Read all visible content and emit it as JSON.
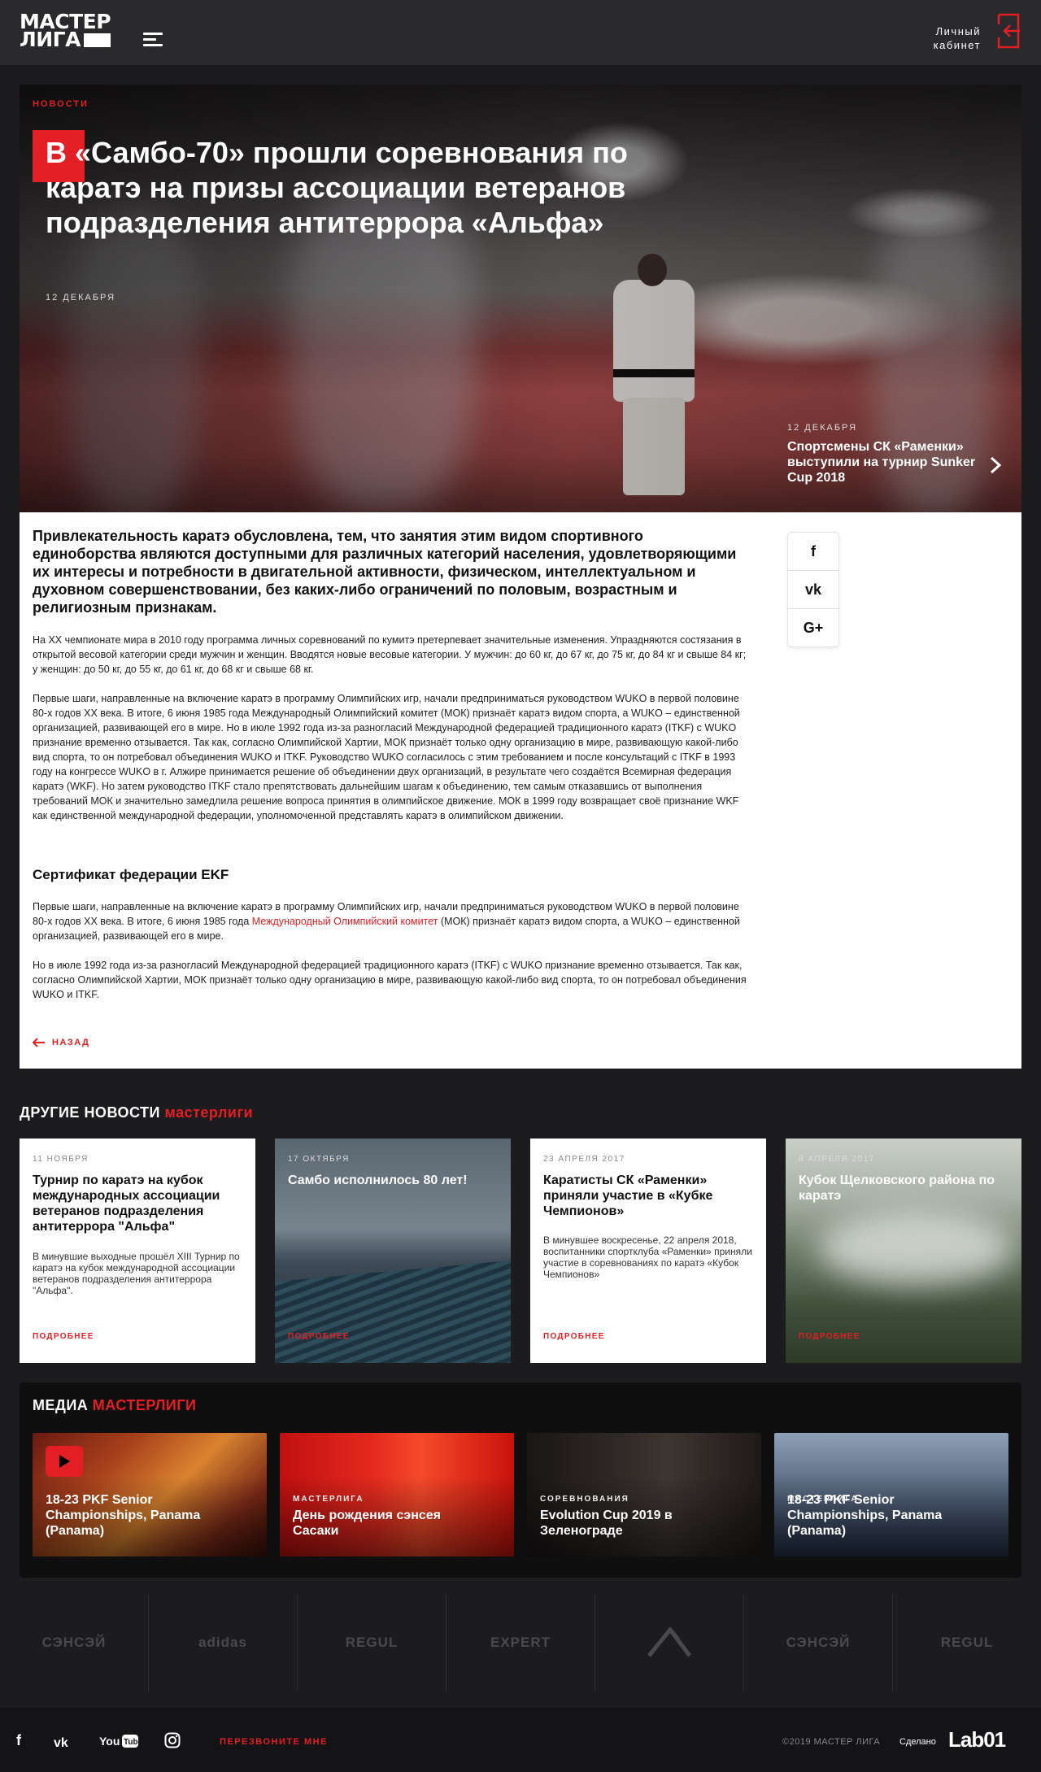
{
  "header": {
    "logo_line1": "МАСТЕР",
    "logo_line2": "ЛИГА",
    "cabinet_line1": "Личный",
    "cabinet_line2": "кабинет"
  },
  "hero": {
    "category": "НОВОСТИ",
    "title": "В «Самбо-70» прошли соревнования по каратэ на призы ассоциации ветеранов подразделения антитеррора «Альфа»",
    "date": "12 ДЕКАБРЯ",
    "next_date": "12 ДЕКАБРЯ",
    "next_title": "Спортсмены СК «Раменки» выступили на турнир Sunker Cup 2018"
  },
  "article": {
    "lead": "Привлекательность каратэ обусловлена, тем, что занятия этим видом спортивного единоборства являются доступными для различных категорий населения, удовлетворяющими их интересы и потребности в двигательной активности, физическом, интеллектуальном и духовном совершенствовании, без каких-либо ограничений по половым, возрастным и религиозным признакам.",
    "p1": "На XX чемпионате мира в 2010 году программа личных соревнований по кумитэ претерпевает значительные изменения. Упраздняются состязания в открытой весовой категории среди мужчин и женщин. Вводятся новые весовые категории. У мужчин: до 60 кг, до 67 кг, до 75 кг, до 84 кг и свыше 84 кг; у женщин: до 50 кг, до 55 кг, до 61 кг, до 68 кг и свыше 68 кг.",
    "p2": "Первые шаги, направленные на включение каратэ в программу Олимпийских игр, начали предприниматься руководством WUKO в первой половине 80-х годов XX века. В итоге, 6 июня 1985 года Международный Олимпийский комитет (МОК) признаёт каратэ видом спорта, а WUKO – единственной организацией, развивающей его в мире. Но в июле 1992 года из-за разногласий Международной федерацией традиционного каратэ (ITKF) с WUKO признание временно отзывается. Так как, согласно Олимпийской Хартии, МОК признаёт только одну организацию в мире, развивающую какой-либо вид спорта, то он потребовал объединения WUKO и ITKF. Руководство WUKO согласилось с этим требованием и после консультаций с ITKF в 1993 году на конгрессе WUKO в г. Алжире принимается решение об объединении двух организаций, в результате чего создаётся Всемирная федерация каратэ (WKF). Но затем руководство ITKF стало препятствовать дальнейшим шагам к объединению, тем самым отказавшись от выполнения требований МОК и значительно замедлила решение вопроса принятия в олимпийское движение. МОК в 1999 году возвращает своё признание WKF как единственной международной федерации, уполномоченной представлять каратэ в олимпийском движении.",
    "cert_title": "Сертификат федерации EKF",
    "p3_a": "Первые шаги, направленные на включение каратэ в программу Олимпийских игр, начали предприниматься руководством WUKO в первой половине 80-х годов XX века. В итоге, 6 июня 1985 года ",
    "p3_link": "Международный Олимпийский комитет",
    "p3_b": " (МОК) признаёт каратэ видом спорта, а WUKO – единственной организацией, развивающей его в мире.",
    "p4": "Но в июле 1992 года из-за разногласий Международной федерацией традиционного каратэ (ITKF) с WUKO признание временно отзывается. Так как, согласно Олимпийской Хартии, МОК признаёт только одну организацию в мире, развивающую какой-либо вид спорта, то он потребовал объединения WUKO и ITKF.",
    "back_label": "НАЗАД",
    "share": [
      "f",
      "vk",
      "G+"
    ]
  },
  "other_news": {
    "title_white": "ДРУГИЕ НОВОСТИ",
    "title_red": "мастерлиги",
    "cards": [
      {
        "date": "11 НОЯБРЯ",
        "title": "Турнир по каратэ на кубок международных ассоциации ветеранов подразделения антитеррора \"Альфа\"",
        "text": "В минувшие выходные прошёл XIII Турнир по каратэ на кубок международной ассоциации ветеранов подразделения антитеррора \"Альфа\".",
        "more": "ПОДРОБНЕЕ"
      },
      {
        "date": "17 ОКТЯБРЯ",
        "title": "Самбо исполнилось 80 лет!",
        "text": "",
        "more": "ПОДРОБНЕЕ"
      },
      {
        "date": "23 АПРЕЛЯ 2017",
        "title": "Каратисты СК «Раменки» приняли участие в «Кубке Чемпионов»",
        "text": "В минувшее воскресенье, 22 апреля 2018, воспитанники спортклуба «Раменки» приняли участие в соревнованиях по каратэ «Кубок Чемпионов»",
        "more": "ПОДРОБНЕЕ"
      },
      {
        "date": "8 АПРЕЛЯ 2017",
        "title": "Кубок Щелковского района по каратэ",
        "text": "",
        "more": "ПОДРОБНЕЕ"
      }
    ]
  },
  "media": {
    "title_white": "МЕДИА",
    "title_red": "МАСТЕРЛИГИ",
    "cards": [
      {
        "category": "",
        "title": "18-23 PKF Senior Championships, Panama (Panama)"
      },
      {
        "category": "МАСТЕРЛИГА",
        "title": "День рождения сэнсея Сасаки"
      },
      {
        "category": "СОРЕВНОВАНИЯ",
        "title": "Evolution Cup 2019 в Зеленограде"
      },
      {
        "category": "МАСТЕРЛИГА",
        "title": "18-23 PKF Senior Championships, Panama (Panama)"
      }
    ]
  },
  "partners": [
    "СЭНСЭЙ",
    "adidas",
    "REGUL",
    "EXPERT",
    "",
    "СЭНСЭЙ",
    "REGUL"
  ],
  "footer": {
    "callback": "ПЕРЕЗВОНИТЕ МНЕ",
    "copyright": "©2019 МАСТЕР ЛИГА",
    "made": "Сделано",
    "studio": "Lab01"
  },
  "colors": {
    "accent": "#e31e24",
    "dark": "#1c1c1e"
  }
}
